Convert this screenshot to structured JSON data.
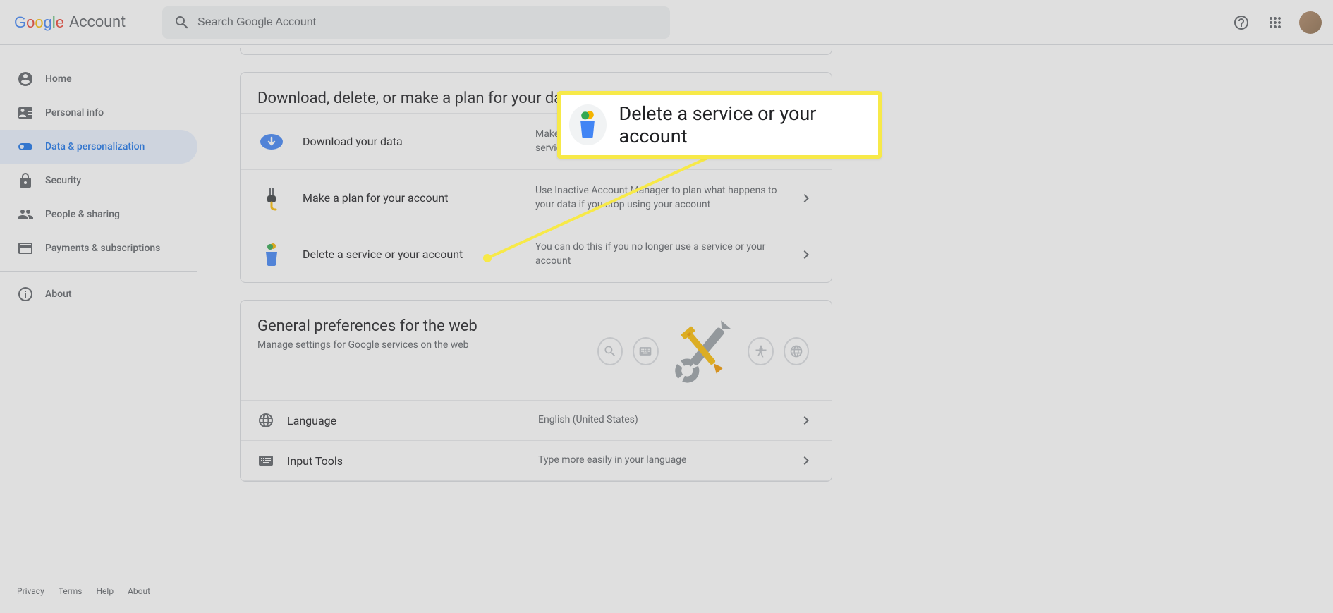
{
  "header": {
    "product": "Account",
    "search_placeholder": "Search Google Account"
  },
  "sidebar": {
    "items": [
      {
        "label": "Home"
      },
      {
        "label": "Personal info"
      },
      {
        "label": "Data & personalization"
      },
      {
        "label": "Security"
      },
      {
        "label": "People & sharing"
      },
      {
        "label": "Payments & subscriptions"
      }
    ],
    "about": "About"
  },
  "footer": {
    "privacy": "Privacy",
    "terms": "Terms",
    "help": "Help",
    "about": "About"
  },
  "card1": {
    "title": "Download, delete, or make a plan for your data",
    "rows": [
      {
        "label": "Download your data",
        "desc": "Make a copy of your data to use it with another account or service"
      },
      {
        "label": "Make a plan for your account",
        "desc": "Use Inactive Account Manager to plan what happens to your data if you stop using your account"
      },
      {
        "label": "Delete a service or your account",
        "desc": "You can do this if you no longer use a service or your account"
      }
    ]
  },
  "card2": {
    "title": "General preferences for the web",
    "sub": "Manage settings for Google services on the web",
    "rows": [
      {
        "label": "Language",
        "desc": "English (United States)"
      },
      {
        "label": "Input Tools",
        "desc": "Type more easily in your language"
      }
    ]
  },
  "callout": {
    "text": "Delete a service or your account"
  }
}
